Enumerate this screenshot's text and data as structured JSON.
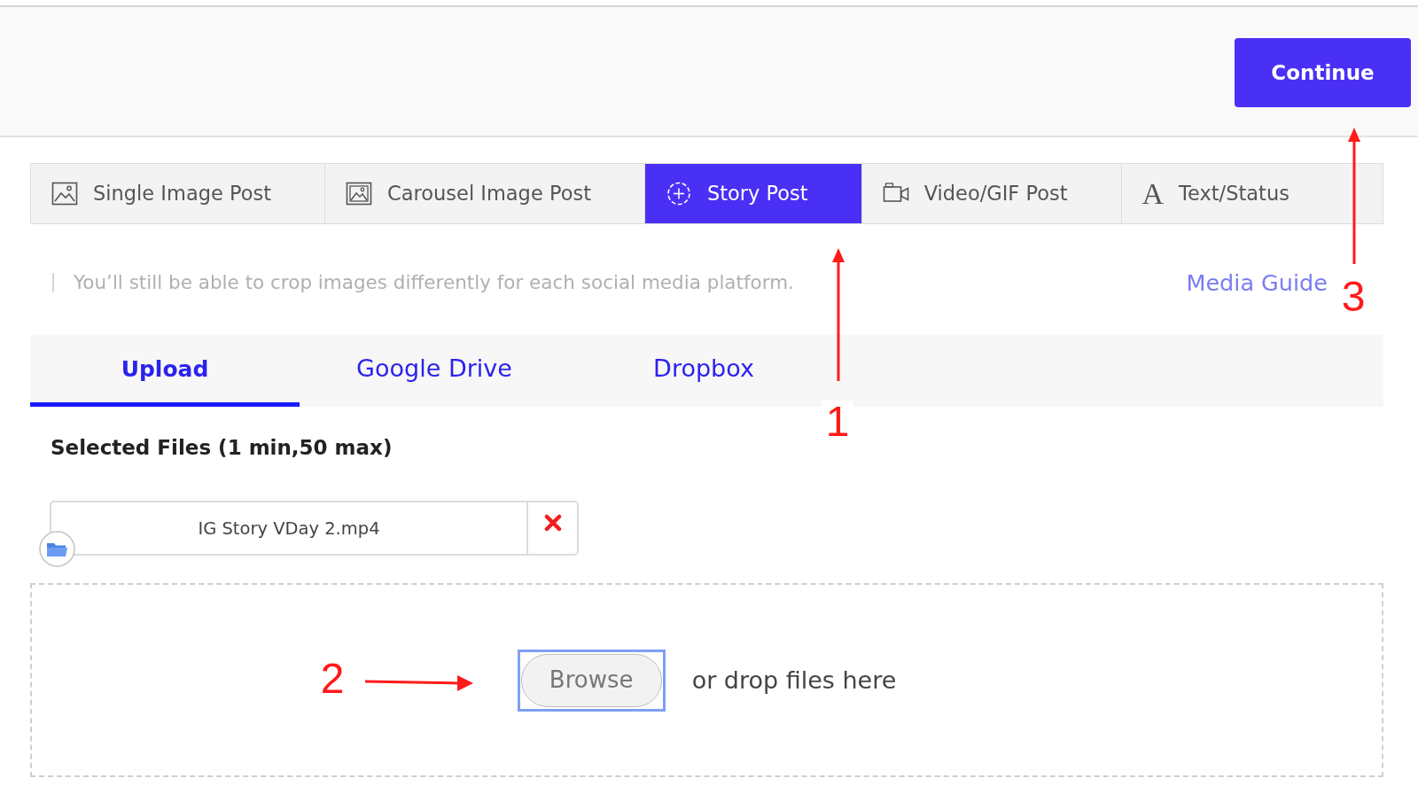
{
  "top_bar": {
    "continue_button": "Continue"
  },
  "post_types": [
    {
      "label": "Single Image Post",
      "kind": "image",
      "selected": false
    },
    {
      "label": "Carousel Image Post",
      "kind": "carousel",
      "selected": false
    },
    {
      "label": "Story Post",
      "kind": "story",
      "selected": true
    },
    {
      "label": "Video/GIF Post",
      "kind": "video",
      "selected": false
    },
    {
      "label": "Text/Status",
      "kind": "text",
      "glyph": "A",
      "selected": false
    }
  ],
  "hint": "You’ll still be able to crop images differently for each social media platform.",
  "media_guide_link": "Media Guide",
  "sources": [
    {
      "label": "Upload",
      "selected": true
    },
    {
      "label": "Google Drive",
      "selected": false
    },
    {
      "label": "Dropbox",
      "selected": false
    }
  ],
  "selected_files": {
    "heading": "Selected Files (1 min,50 max)",
    "files": [
      {
        "name": "IG Story VDay 2.mp4"
      }
    ]
  },
  "drop_zone": {
    "browse_button": {
      "label": "Browse",
      "focused": true
    },
    "text": "or drop files here"
  },
  "annotations": [
    {
      "label": "1",
      "kind": "up"
    },
    {
      "label": "2",
      "kind": "right"
    },
    {
      "label": "3",
      "kind": "up"
    }
  ]
}
